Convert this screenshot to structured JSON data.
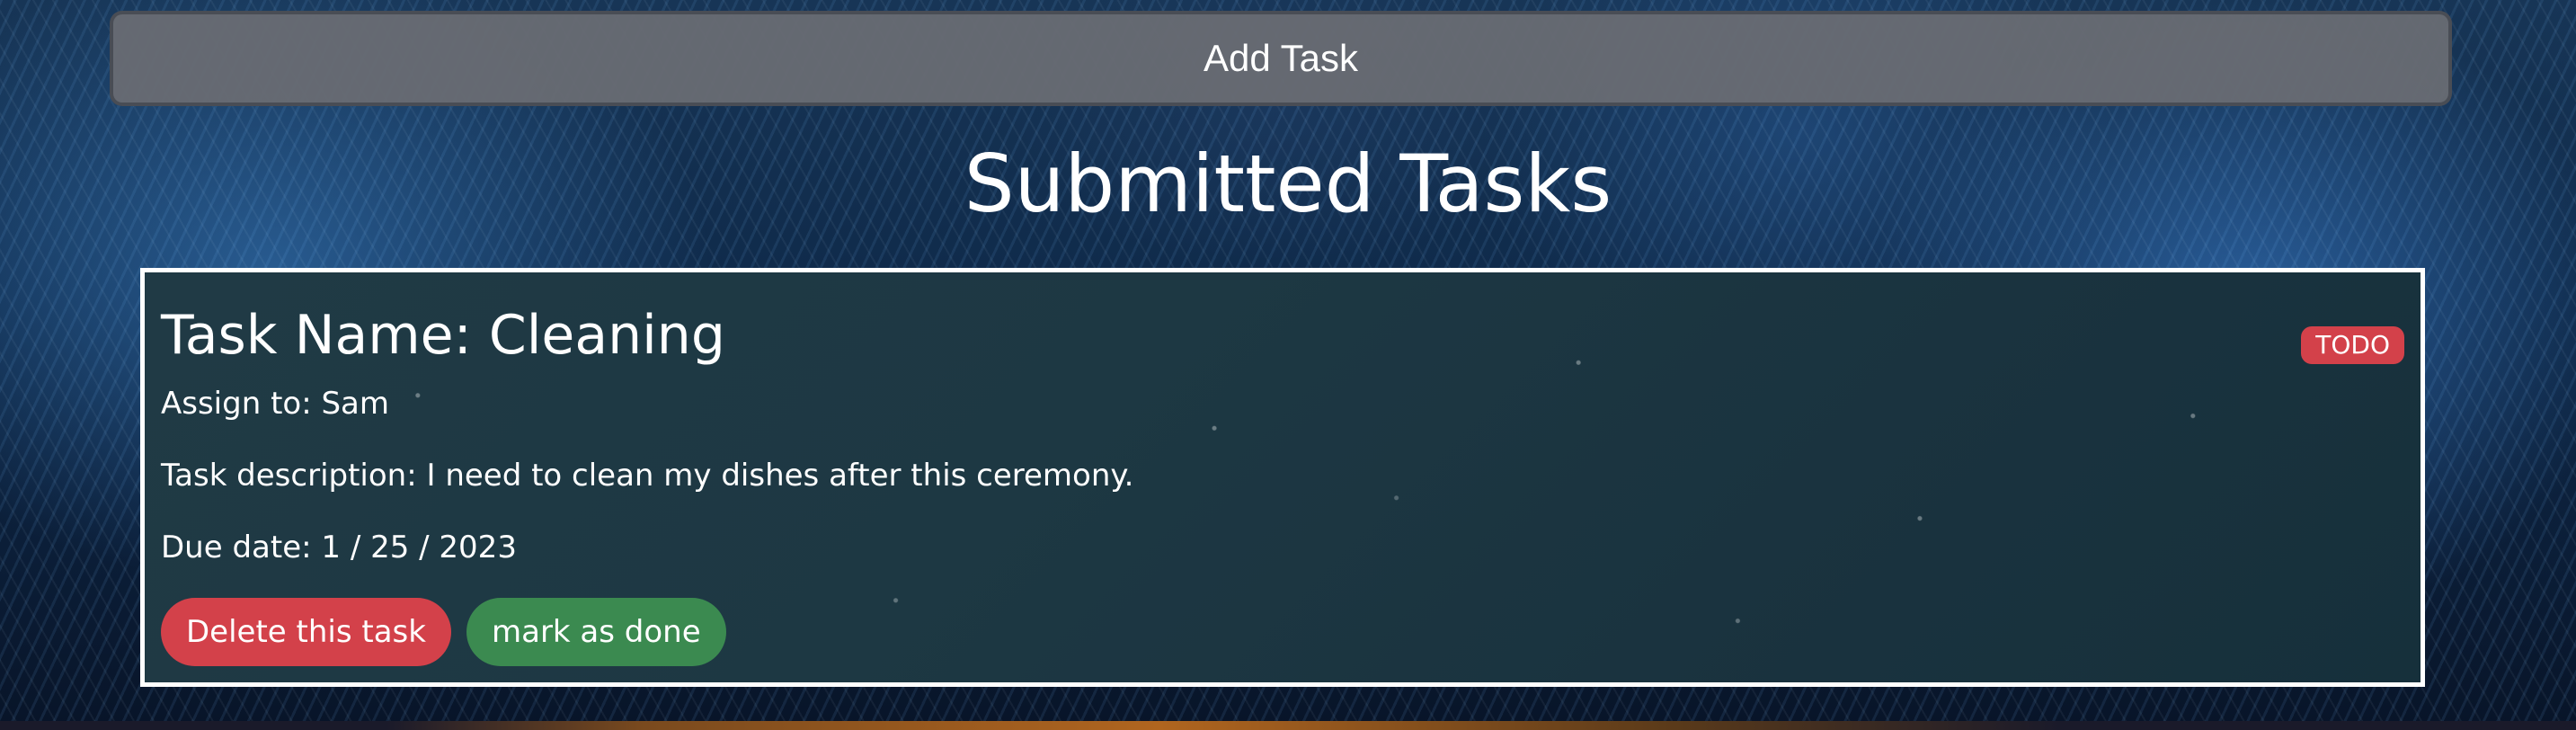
{
  "header": {
    "add_task_label": "Add Task"
  },
  "main": {
    "title": "Submitted Tasks",
    "tasks": [
      {
        "name": "Task Name: Cleaning",
        "status": "TODO",
        "assign": "Assign to: Sam",
        "description": "Task description: I need to clean my dishes after this ceremony.",
        "due": "Due date: 1 / 25 / 2023",
        "delete_label": "Delete this task",
        "done_label": "mark as done"
      }
    ]
  },
  "colors": {
    "status_todo": "#d3414a",
    "delete_button": "#d3414a",
    "done_button": "#3b8a50"
  }
}
